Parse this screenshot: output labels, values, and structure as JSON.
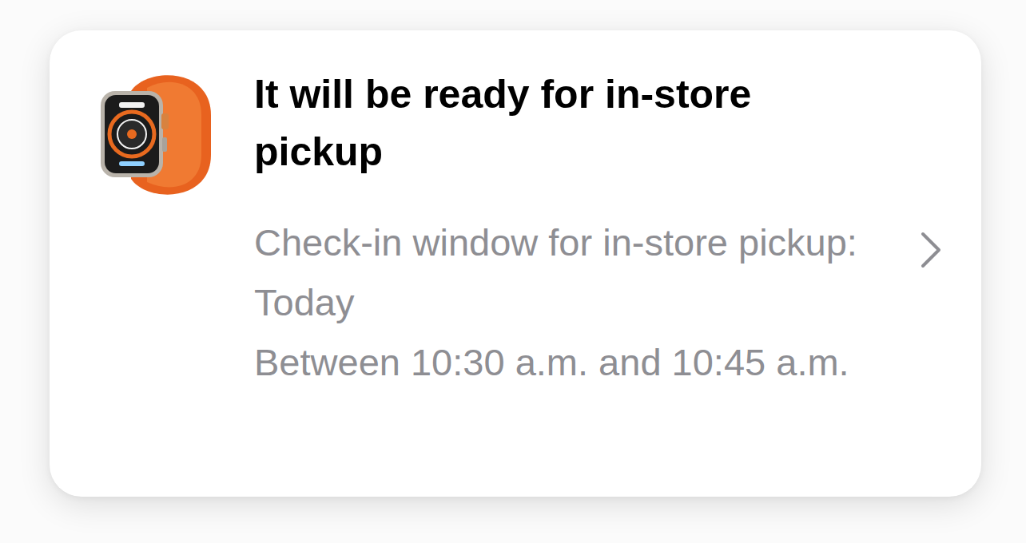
{
  "card": {
    "title": "It will be ready for in-store pickup",
    "details": [
      "Check-in window for in-store pickup: Today",
      "Between 10:30 a.m. and 10:45 a.m."
    ]
  }
}
